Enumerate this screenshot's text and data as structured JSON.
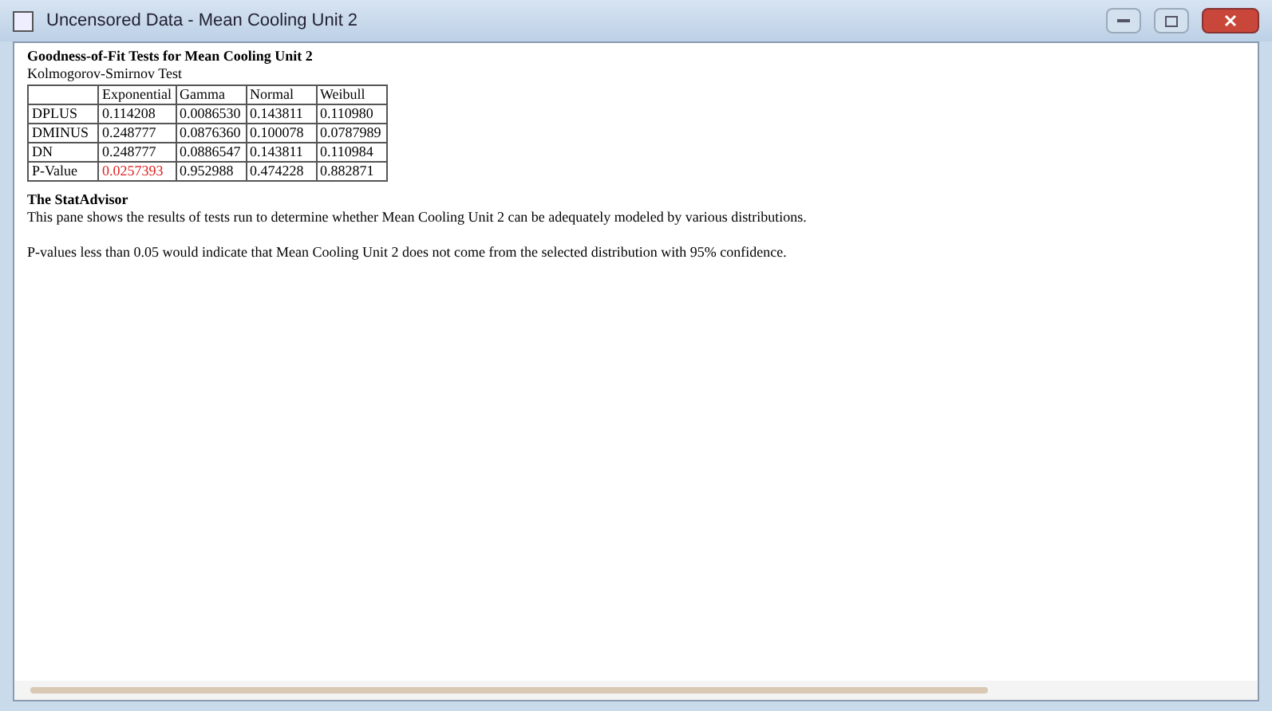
{
  "window": {
    "title": "Uncensored Data - Mean Cooling Unit 2"
  },
  "heading": "Goodness-of-Fit Tests for Mean Cooling Unit 2",
  "subheading": "Kolmogorov-Smirnov Test",
  "table": {
    "columns": [
      "Exponential",
      "Gamma",
      "Normal",
      "Weibull"
    ],
    "rows": [
      {
        "label": "DPLUS",
        "cells": [
          {
            "text": "0.114208",
            "flagged": false
          },
          {
            "text": "0.0086530",
            "flagged": false
          },
          {
            "text": "0.143811",
            "flagged": false
          },
          {
            "text": "0.110980",
            "flagged": false
          }
        ]
      },
      {
        "label": "DMINUS",
        "cells": [
          {
            "text": "0.248777",
            "flagged": false
          },
          {
            "text": "0.0876360",
            "flagged": false
          },
          {
            "text": "0.100078",
            "flagged": false
          },
          {
            "text": "0.0787989",
            "flagged": false
          }
        ]
      },
      {
        "label": "DN",
        "cells": [
          {
            "text": "0.248777",
            "flagged": false
          },
          {
            "text": "0.0886547",
            "flagged": false
          },
          {
            "text": "0.143811",
            "flagged": false
          },
          {
            "text": "0.110984",
            "flagged": false
          }
        ]
      },
      {
        "label": "P-Value",
        "cells": [
          {
            "text": "0.0257393",
            "flagged": true
          },
          {
            "text": "0.952988",
            "flagged": false
          },
          {
            "text": "0.474228",
            "flagged": false
          },
          {
            "text": "0.882871",
            "flagged": false
          }
        ]
      }
    ]
  },
  "advisor": {
    "title": "The StatAdvisor",
    "paragraphs": [
      "This pane shows the results of tests run to determine whether Mean Cooling Unit 2 can be adequately modeled by various distributions.",
      "P-values less than 0.05 would indicate that Mean Cooling Unit 2 does not come from the selected distribution with 95% confidence."
    ]
  }
}
